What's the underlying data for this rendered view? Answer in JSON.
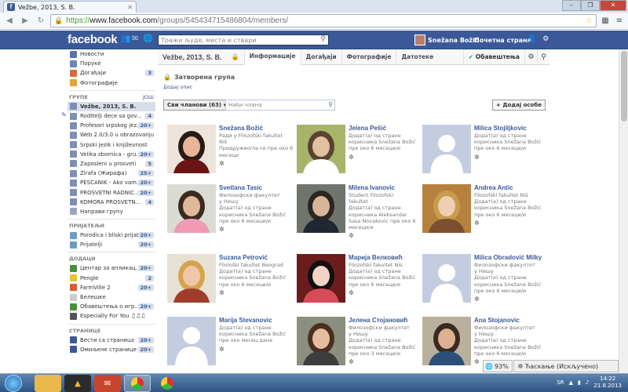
{
  "browser": {
    "tab_title": "Vežbe, 2013, S. B.",
    "url_scheme": "https://",
    "url_host": "www.facebook.com",
    "url_path": "/groups/545434715486804/members/"
  },
  "fb_header": {
    "logo": "facebook",
    "search_placeholder": "Тражи људе, места и ствари",
    "user_name": "Snežana Božić",
    "home": "Почетна страна"
  },
  "left_nav": {
    "top_items": [
      {
        "label": "Новости",
        "icon": "news-feed-icon",
        "color": "#5b74a8"
      },
      {
        "label": "Поруке",
        "icon": "messages-icon",
        "color": "#6c86b8"
      },
      {
        "label": "Догађаји",
        "icon": "events-icon",
        "color": "#d66a3b",
        "badge": "3"
      },
      {
        "label": "Фотографије",
        "icon": "photos-icon",
        "color": "#e0a437"
      }
    ],
    "groups_heading": "ГРУПЕ",
    "groups_more": "ЈОШ",
    "groups": [
      {
        "label": "Vežbe, 2013, S. B.",
        "color": "#7d8fb3",
        "selected": true
      },
      {
        "label": "Roditelji dece sa gov...",
        "color": "#7d8fb3",
        "badge": "4"
      },
      {
        "label": "Profesori srpskog jez...",
        "color": "#7d8fb3",
        "badge": "20+"
      },
      {
        "label": "Web 2.0/3.0 u obrazovanju",
        "color": "#7d8fb3"
      },
      {
        "label": "Srpski jezik i književnost",
        "color": "#7d8fb3"
      },
      {
        "label": "Velika zbornica - gru...",
        "color": "#7d8fb3",
        "badge": "20+"
      },
      {
        "label": "Zaposleni u prosveti",
        "color": "#7d8fb3",
        "badge": "5"
      },
      {
        "label": "Žirafa (Жирафа)",
        "color": "#7d8fb3",
        "badge": "25+"
      },
      {
        "label": "PEŠČANIK - Ako vam...",
        "color": "#7d8fb3",
        "badge": "20+"
      },
      {
        "label": "PROSVETNI RADNIC...",
        "color": "#7d8fb3",
        "badge": "20+"
      },
      {
        "label": "KOMORA PROSVETN...",
        "color": "#7d8fb3",
        "badge": "4"
      },
      {
        "label": "Направи групу",
        "color": "#9aa7bf"
      }
    ],
    "friends_heading": "ПРИЈАТЕЉИ",
    "friends": [
      {
        "label": "Porodica i bliski prijat...",
        "color": "#6f9ac8",
        "badge": "20+"
      },
      {
        "label": "Prijatelji",
        "color": "#6f9ac8",
        "badge": "20+"
      }
    ],
    "apps_heading": "ДОДАЦИ",
    "apps": [
      {
        "label": "Центар за апликац...",
        "color": "#4b8e3c",
        "badge": "20+"
      },
      {
        "label": "Pengle",
        "color": "#e8c337",
        "badge": "2"
      },
      {
        "label": "FarmVille 2",
        "color": "#d45c3a",
        "badge": "20+"
      },
      {
        "label": "Белешке",
        "color": "#cccccc"
      },
      {
        "label": "Обавештења о игр...",
        "color": "#4b8e3c",
        "badge": "20+"
      },
      {
        "label": "Especially For You ♫♫♫",
        "color": "#555555"
      }
    ],
    "pages_heading": "СТРАНИЦЕ",
    "pages": [
      {
        "label": "Вести са страница",
        "color": "#3b5998",
        "badge": "20+"
      },
      {
        "label": "Омиљене странице",
        "color": "#3b5998",
        "badge": "20+"
      }
    ]
  },
  "group": {
    "title": "Vežbe, 2013, S. B.",
    "tabs": [
      "Информације",
      "Догађаји",
      "Фотографије",
      "Датотеке"
    ],
    "notify": "Обавештења",
    "closed_group": "Затворена група",
    "add_description": "Додај опис",
    "all_members": "Сви чланови (63)",
    "find_member_placeholder": "Нађи члана",
    "add_people": "+ Додај особе"
  },
  "members": [
    {
      "name": "Snežana Božić",
      "lines": [
        "Ради у Filozofski fakultet",
        "Niš",
        "Придружио/ла се пре око 6",
        "месеци"
      ],
      "photo": "woman-dark-hair"
    },
    {
      "name": "Jelena Pešić",
      "lines": [
        "Додат(а) од стране",
        "корисника Snežana Božić",
        "пре око 6 месеци/и"
      ],
      "photo": "woman-outdoor"
    },
    {
      "name": "Milica Stojiljkovic",
      "lines": [
        "Додат(а) од стране",
        "корисника Snežana Božić",
        "пре око 6 месеци/и"
      ],
      "photo": "silhouette"
    },
    {
      "name": "Svetlana Tasic",
      "lines": [
        "Филозофски факултет",
        "у Нишу",
        "Додат(а) од стране",
        "корисника Snežana Božić",
        "пре око 6 месеци/и"
      ],
      "photo": "woman-pink"
    },
    {
      "name": "Milena Ivanovic",
      "lines": [
        "Student Filozofski",
        "fakultet",
        "Додат(а) од стране",
        "корисника Aleksandar",
        "Sasa Novakovic пре око 6",
        "месеци/и"
      ],
      "photo": "couple-street"
    },
    {
      "name": "Andrea Antic",
      "lines": [
        "Filozofski fakultet Niš",
        "Додат(а) од стране",
        "корисника Snežana Božić",
        "пре око 6 месеци/и"
      ],
      "photo": "woman-blonde"
    },
    {
      "name": "Suzana Petrović",
      "lines": [
        "Filološki fakultet Beograd",
        "Додат(а) од стране",
        "корисника Snežana Božić",
        "пре око 6 месеци/и"
      ],
      "photo": "woman-blonde-smile"
    },
    {
      "name": "Марија Велковић",
      "lines": [
        "Filozofski fakultet Nis",
        "Додат(а) од стране",
        "корисника Snežana Božić",
        "пре око 6 месеци/и"
      ],
      "photo": "cartoon-girl"
    },
    {
      "name": "Milica Obradović Milky",
      "lines": [
        "Филозофски факултет",
        "у Нишу",
        "Додат(а) од стране",
        "корисника Snežana Božić",
        "пре око 6 месеци/и"
      ],
      "photo": "silhouette"
    },
    {
      "name": "Marija Stevanovic",
      "lines": [
        "Додат(а) од стране",
        "корисника Snežana Božić",
        "пре око месец дана"
      ],
      "photo": "silhouette"
    },
    {
      "name": "Јелена Стојановић",
      "lines": [
        "Филозофски факултет",
        "у Нишу",
        "Додат(а) од стране",
        "корисника Snežana Božić",
        "пре око 3 месеци/и"
      ],
      "photo": "woman-brown-hair"
    },
    {
      "name": "Ana Stojanovic",
      "lines": [
        "Филозофски факултет",
        "у Нишу",
        "Додат(а) од стране",
        "корисника Snežana Božić",
        "пре око 6 месеци/и"
      ],
      "photo": "woman-rocks"
    }
  ],
  "chat": {
    "zoom": "93%",
    "status": "Ћаскање (Искључено)"
  },
  "taskbar": {
    "lang": "SR",
    "time": "14:22",
    "date": "21.8.2013"
  }
}
